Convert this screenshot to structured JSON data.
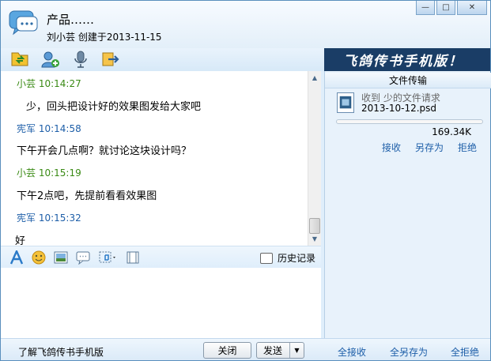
{
  "window": {
    "contact_name": "产品……",
    "subtitle": "刘小芸 创建于2013-11-15",
    "controls": {
      "minimize": "—",
      "maximize": "□",
      "close": "✕"
    }
  },
  "toolbar": {
    "icons": [
      "file-transfer-icon",
      "add-member-icon",
      "voice-icon",
      "exit-icon"
    ],
    "banner": "飞鸽传书手机版！"
  },
  "messages": [
    {
      "sender": "小芸",
      "time": "10:14:27",
      "text": "少，回头把设计好的效果图发给大家吧"
    },
    {
      "sender": "宪军",
      "time": "10:14:58",
      "text": "下午开会几点啊？就讨论这块设计吗？"
    },
    {
      "sender": "小芸",
      "time": "10:15:19",
      "text": "下午2点吧，先提前看看效果图"
    },
    {
      "sender": "宪军",
      "time": "10:15:32",
      "text": "好"
    }
  ],
  "input_toolbar": {
    "icons": [
      "font-icon",
      "emoji-icon",
      "image-icon",
      "message-icon",
      "screenshot-icon",
      "window-icon"
    ],
    "history_label": "历史记录"
  },
  "file_transfer": {
    "title": "文件传输",
    "received_text": "收到  少的文件请求",
    "file_name": "2013-10-12.psd",
    "progress_fraction": 0.0,
    "file_size": "169.34K",
    "actions": {
      "accept": "接收",
      "save_as": "另存为",
      "reject": "拒绝"
    }
  },
  "bottom": {
    "learn_link": "了解飞鸽传书手机版",
    "close_button": "关闭",
    "send_button": "发送",
    "accept_all": "全接收",
    "save_all": "全另存为",
    "reject_all": "全拒绝"
  },
  "colors": {
    "sender_green": "#3a8a14",
    "sender_blue": "#1d5ea8",
    "banner_bg": "#1a3d66",
    "link": "#1d5ea8"
  }
}
